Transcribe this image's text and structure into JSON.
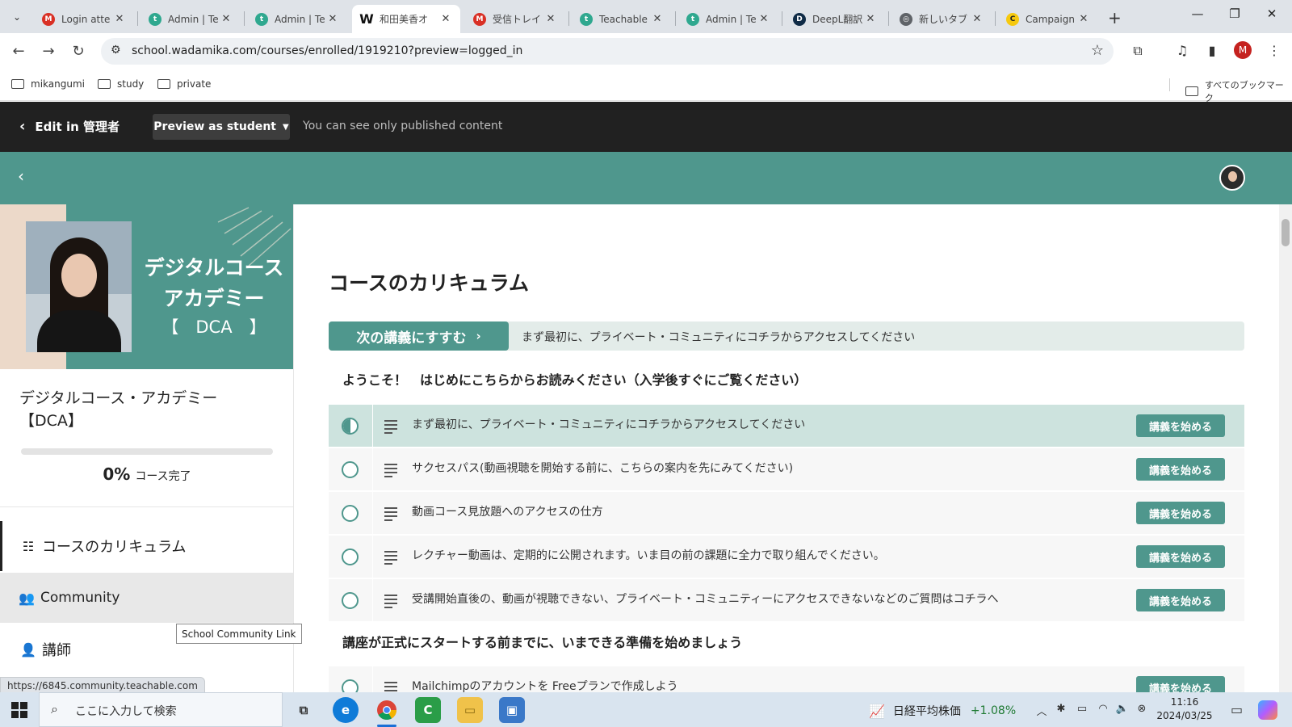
{
  "browser": {
    "tabs": [
      {
        "title": "Login atte",
        "icon": "gmail-icon",
        "color": "#d93025",
        "glyph": "M"
      },
      {
        "title": "Admin | Te",
        "icon": "teachable-icon",
        "color": "#2fa88f",
        "glyph": "t"
      },
      {
        "title": "Admin | Te",
        "icon": "teachable-icon",
        "color": "#2fa88f",
        "glyph": "t"
      },
      {
        "title": "和田美香オ",
        "icon": "wordpress-icon",
        "color": "#111111",
        "glyph": "W"
      },
      {
        "title": "受信トレイ (",
        "icon": "gmail-icon",
        "color": "#d93025",
        "glyph": "M"
      },
      {
        "title": "Teachable",
        "icon": "teachable-icon",
        "color": "#2fa88f",
        "glyph": "t"
      },
      {
        "title": "Admin | Te",
        "icon": "teachable-icon",
        "color": "#2fa88f",
        "glyph": "t"
      },
      {
        "title": "DeepL翻訳",
        "icon": "deepl-icon",
        "color": "#0f2b46",
        "glyph": "D"
      },
      {
        "title": "新しいタブ",
        "icon": "chrome-icon",
        "color": "#5f6368",
        "glyph": "◎"
      },
      {
        "title": "Campaign",
        "icon": "mailchimp-icon",
        "color": "#f6c90e",
        "glyph": "C"
      }
    ],
    "url": "school.wadamika.com/courses/enrolled/1919210?preview=logged_in",
    "bookmarks": [
      "mikangumi",
      "study",
      "private"
    ],
    "all_bookmarks": "すべてのブックマーク",
    "profile_initial": "M",
    "status_url": "https://6845.community.teachable.com"
  },
  "admin_bar": {
    "edit_label": "Edit in 管理者",
    "preview_label": "Preview as student",
    "note": "You can see only published content"
  },
  "sidebar": {
    "banner_title_line1": "デジタルコース",
    "banner_title_line2": "アカデミー",
    "banner_code": "【　DCA　】",
    "course_name_line1": "デジタルコース・アカデミー",
    "course_name_line2": "【DCA】",
    "progress_percent": 0,
    "progress_value": "0%",
    "progress_label": "コース完了",
    "nav": [
      {
        "label": "コースのカリキュラム",
        "icon": "curriculum-icon"
      },
      {
        "label": "Community",
        "icon": "community-icon"
      },
      {
        "label": "講師",
        "icon": "person-icon"
      }
    ],
    "tooltip": "School Community Link"
  },
  "main": {
    "heading": "コースのカリキュラム",
    "next_button": "次の講義にすすむ",
    "next_lecture": "まず最初に、プライベート・コミュニティにコチラからアクセスしてください",
    "sections": [
      {
        "title": "ようこそ！　はじめにこちらからお読みください（入学後すぐにご覧ください）",
        "lectures": [
          {
            "title": "まず最初に、プライベート・コミュニティにコチラからアクセスしてください",
            "button": "講義を始める",
            "status": "in-progress"
          },
          {
            "title": "サクセスパス(動画視聴を開始する前に、こちらの案内を先にみてください)",
            "button": "講義を始める",
            "status": "not-started"
          },
          {
            "title": "動画コース見放題へのアクセスの仕方",
            "button": "講義を始める",
            "status": "not-started"
          },
          {
            "title": "レクチャー動画は、定期的に公開されます。いま目の前の課題に全力で取り組んでください。",
            "button": "講義を始める",
            "status": "not-started"
          },
          {
            "title": "受講開始直後の、動画が視聴できない、プライベート・コミュニティーにアクセスできないなどのご質問はコチラへ",
            "button": "講義を始める",
            "status": "not-started"
          }
        ]
      },
      {
        "title": "講座が正式にスタートする前までに、いまできる準備を始めましょう",
        "lectures": [
          {
            "title": "Mailchimpのアカウントを Freeプランで作成しよう",
            "button": "講義を始める",
            "status": "not-started"
          }
        ]
      }
    ]
  },
  "taskbar": {
    "search_placeholder": "ここに入力して検索",
    "stock_name": "日経平均株価",
    "stock_change": "+1.08%",
    "time": "11:16",
    "date": "2024/03/25"
  },
  "colors": {
    "teal": "#4f978d",
    "admin_bar": "#212121"
  }
}
